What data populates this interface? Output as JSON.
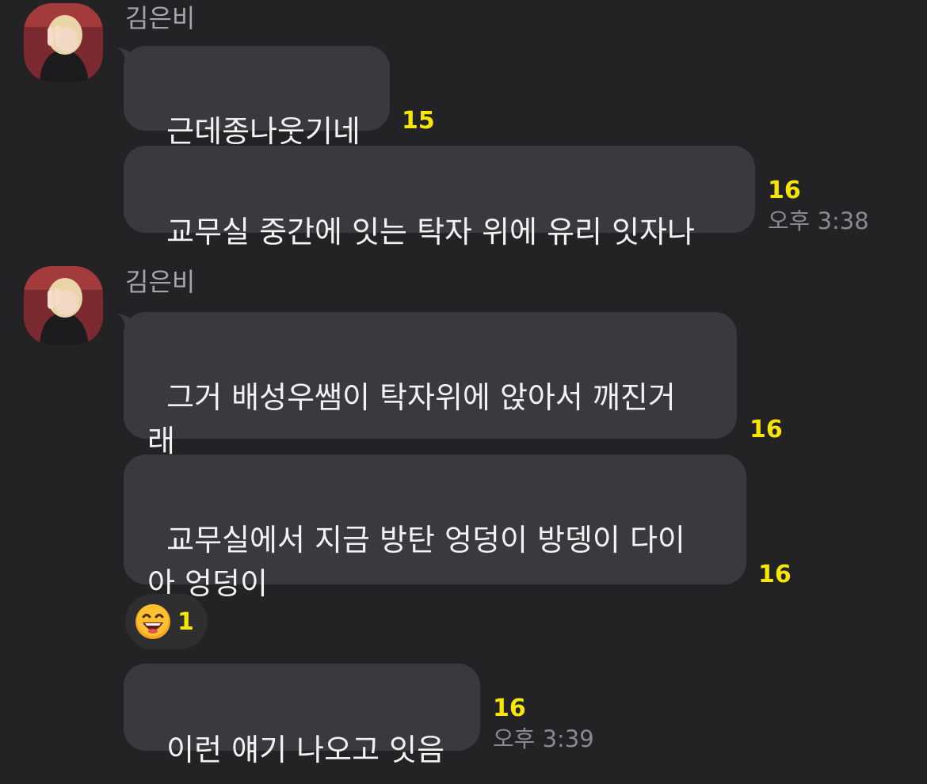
{
  "colors": {
    "background": "#232325",
    "bubble": "#3a3a3e",
    "unread_count": "#f7e600",
    "sender_name": "#a6a6aa",
    "timestamp": "#8a8a8e"
  },
  "groups": [
    {
      "sender": "김은비",
      "avatar_icon": "profile-photo-avatar",
      "messages": [
        {
          "text": "근데종나웃기네",
          "unread": "15"
        },
        {
          "text": "교무실 중간에 잇는 탁자 위에 유리 잇자나",
          "unread": "16",
          "time": "오후 3:38"
        }
      ]
    },
    {
      "sender": "김은비",
      "avatar_icon": "profile-photo-avatar",
      "messages": [
        {
          "text": "그거 배성우쌤이 탁자위에 앉아서 깨진거\n래",
          "unread": "16"
        },
        {
          "text": "교무실에서 지금 방탄 엉덩이 방뎅이 다이\n아 엉덩이",
          "unread": "16"
        },
        {
          "text": "이런 얘기 나오고 잇음",
          "unread": "16",
          "time": "오후 3:39"
        }
      ],
      "reaction": {
        "icon": "grinning-face-emoji",
        "count": "1"
      }
    }
  ]
}
